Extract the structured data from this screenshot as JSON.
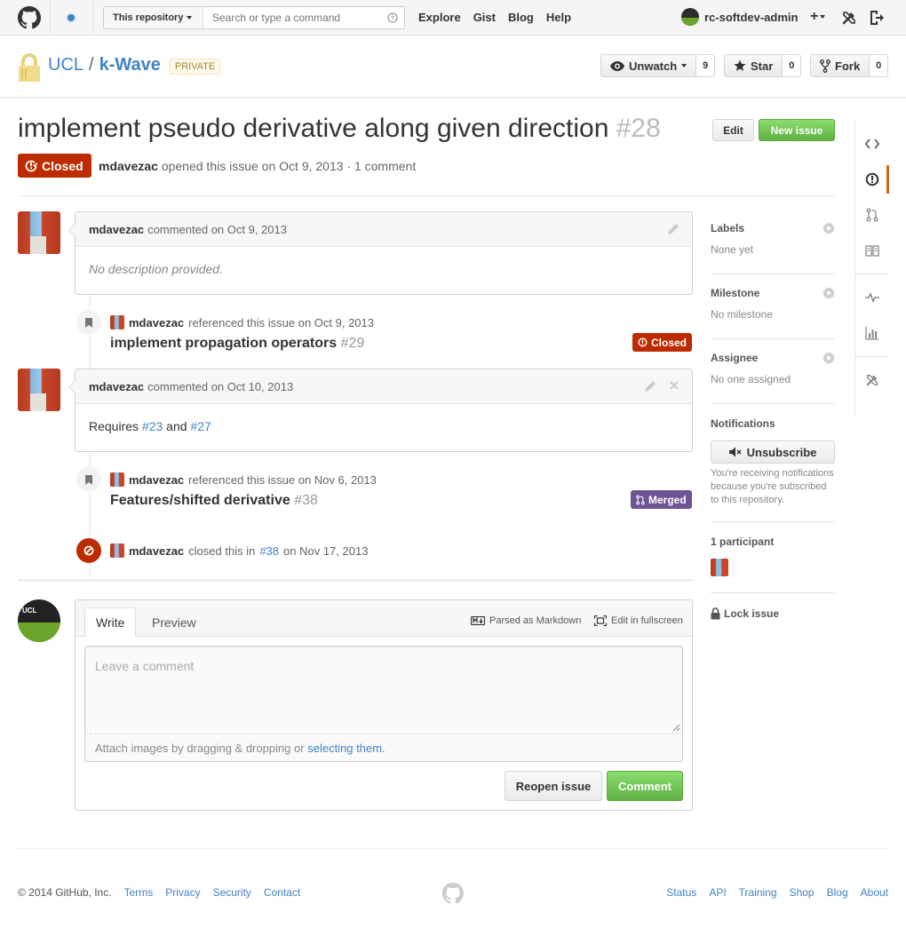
{
  "header": {
    "search_scope": "This repository",
    "search_placeholder": "Search or type a command",
    "nav": [
      "Explore",
      "Gist",
      "Blog",
      "Help"
    ],
    "username": "rc-softdev-admin",
    "plus_label": "+"
  },
  "repo": {
    "owner": "UCL",
    "separator": "/",
    "name": "k-Wave",
    "visibility": "PRIVATE",
    "watch_label": "Unwatch",
    "watch_count": "9",
    "star_label": "Star",
    "star_count": "0",
    "fork_label": "Fork",
    "fork_count": "0"
  },
  "issue": {
    "title": "implement pseudo derivative along given direction",
    "number": "#28",
    "edit_label": "Edit",
    "new_issue_label": "New issue",
    "state": "Closed",
    "author": "mdavezac",
    "meta": "opened this issue on Oct 9, 2013 · 1 comment"
  },
  "timeline": {
    "comment1": {
      "author": "mdavezac",
      "meta": "commented on Oct 9, 2013",
      "body": "No description provided."
    },
    "ref1": {
      "author": "mdavezac",
      "meta": "referenced this issue on Oct 9, 2013",
      "title": "implement propagation operators",
      "number": "#29",
      "state": "Closed"
    },
    "comment2": {
      "author": "mdavezac",
      "meta": "commented on Oct 10, 2013",
      "body_prefix": "Requires",
      "link1": "#23",
      "conj": "and",
      "link2": "#27"
    },
    "ref2": {
      "author": "mdavezac",
      "meta": "referenced this issue on Nov 6, 2013",
      "title": "Features/shifted derivative",
      "number": "#38",
      "state": "Merged"
    },
    "closed_event": {
      "author": "mdavezac",
      "text1": "closed this in",
      "link": "#38",
      "text2": "on Nov 17, 2013"
    }
  },
  "form": {
    "avatar_text": "UCL",
    "tab_write": "Write",
    "tab_preview": "Preview",
    "markdown_label": "Parsed as Markdown",
    "fullscreen_label": "Edit in fullscreen",
    "placeholder": "Leave a comment",
    "attach_text": "Attach images by dragging & dropping or",
    "attach_link": "selecting them",
    "attach_end": ".",
    "reopen_label": "Reopen issue",
    "comment_label": "Comment"
  },
  "sidebar": {
    "labels_heading": "Labels",
    "labels_value": "None yet",
    "milestone_heading": "Milestone",
    "milestone_value": "No milestone",
    "assignee_heading": "Assignee",
    "assignee_value": "No one assigned",
    "notifications_heading": "Notifications",
    "unsubscribe_label": "Unsubscribe",
    "notifications_note": "You're receiving notifications because you're subscribed to this repository.",
    "participants_heading": "1 participant",
    "lock_label": "Lock issue"
  },
  "footer": {
    "copyright": "© 2014 GitHub, Inc.",
    "left_links": [
      "Terms",
      "Privacy",
      "Security",
      "Contact"
    ],
    "right_links": [
      "Status",
      "API",
      "Training",
      "Shop",
      "Blog",
      "About"
    ]
  },
  "colors": {
    "link": "#4183c4",
    "closed": "#bd2c00",
    "merged": "#6e5494",
    "green": "#6cc644",
    "repo_nav_selected": "#d26911"
  }
}
